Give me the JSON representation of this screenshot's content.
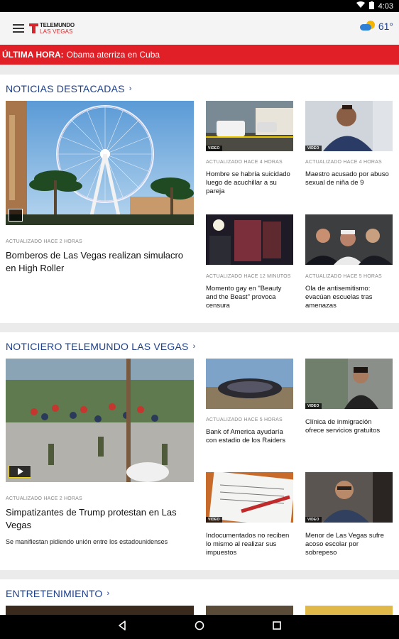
{
  "status": {
    "time": "4:03",
    "wifi_icon": "wifi-icon",
    "battery_icon": "battery-icon"
  },
  "header": {
    "logo_line1": "TELEMUNDO",
    "logo_line2": "LAS VEGAS",
    "temperature": "61°",
    "weather_icon": "partly-cloudy-icon"
  },
  "breaking": {
    "label": "ÚLTIMA HORA:",
    "text": "Obama aterriza en Cuba"
  },
  "sections": [
    {
      "title": "NOTICIAS DESTACADAS",
      "main": {
        "meta": "ACTUALIZADO HACE 2 HORAS",
        "headline": "Bomberos de Las Vegas realizan simulacro en High Roller"
      },
      "items": [
        {
          "badge": "VIDEO",
          "meta": "ACTUALIZADO HACE 4 HORAS",
          "headline": "Hombre se habría suicidado luego de acuchillar a su pareja"
        },
        {
          "badge": "VIDEO",
          "meta": "ACTUALIZADO HACE 4 HORAS",
          "headline": "Maestro acusado por abuso sexual de niña de 9"
        },
        {
          "badge": "",
          "meta": "ACTUALIZADO HACE 12 MINUTOS",
          "headline": "Momento gay en \"Beauty and the Beast\" provoca censura"
        },
        {
          "badge": "",
          "meta": "ACTUALIZADO HACE 5 HORAS",
          "headline": "Ola de antisemitismo: evacúan escuelas tras amenazas"
        }
      ]
    },
    {
      "title": "NOTICIERO TELEMUNDO LAS VEGAS",
      "main": {
        "meta": "ACTUALIZADO HACE 2 HORAS",
        "headline": "Simpatizantes de Trump protestan en Las Vegas",
        "description": "Se manifiestan pidiendo unión entre los estadounidenses"
      },
      "items": [
        {
          "badge": "",
          "meta": "ACTUALIZADO HACE 5 HORAS",
          "headline": "Bank of America ayudaría con estadio de los Raiders"
        },
        {
          "badge": "VIDEO",
          "meta": "",
          "headline": "Clínica de inmigración ofrece servicios gratuitos"
        },
        {
          "badge": "VIDEO",
          "meta": "",
          "headline": "Indocumentados no reciben lo mismo al realizar sus impuestos"
        },
        {
          "badge": "VIDEO",
          "meta": "",
          "headline": "Menor de Las Vegas sufre acoso escolar por sobrepeso"
        }
      ]
    },
    {
      "title": "ENTRETENIMIENTO"
    }
  ]
}
